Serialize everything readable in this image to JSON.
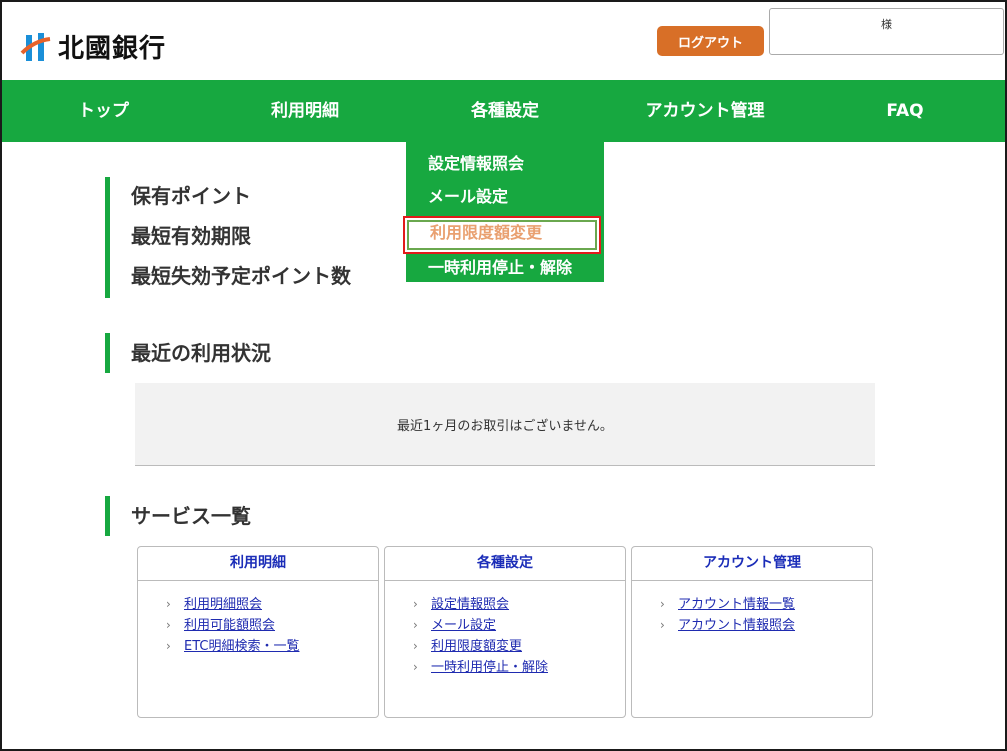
{
  "header": {
    "brand": "北國銀行",
    "logout_label": "ログアウト",
    "user_suffix": "様"
  },
  "nav": {
    "items": [
      "トップ",
      "利用明細",
      "各種設定",
      "アカウント管理",
      "FAQ"
    ]
  },
  "dropdown": {
    "items": [
      "設定情報照会",
      "メール設定",
      "利用限度額変更",
      "一時利用停止・解除"
    ],
    "highlighted": "利用限度額変更"
  },
  "points": {
    "labels": [
      "保有ポイント",
      "最短有効期限",
      "最短失効予定ポイント数"
    ]
  },
  "recent": {
    "heading": "最近の利用状況",
    "message": "最近1ヶ月のお取引はございません。"
  },
  "services": {
    "heading": "サービス一覧",
    "cards": [
      {
        "title": "利用明細",
        "links": [
          "利用明細照会",
          "利用可能額照会",
          "ETC明細検索・一覧"
        ]
      },
      {
        "title": "各種設定",
        "links": [
          "設定情報照会",
          "メール設定",
          "利用限度額変更",
          "一時利用停止・解除"
        ]
      },
      {
        "title": "アカウント管理",
        "links": [
          "アカウント情報一覧",
          "アカウント情報照会"
        ]
      }
    ]
  },
  "colors": {
    "brand_green": "#17a840",
    "logout_orange": "#d86f27",
    "link_blue": "#1f2bb0",
    "highlight_red": "#e21b1b"
  }
}
